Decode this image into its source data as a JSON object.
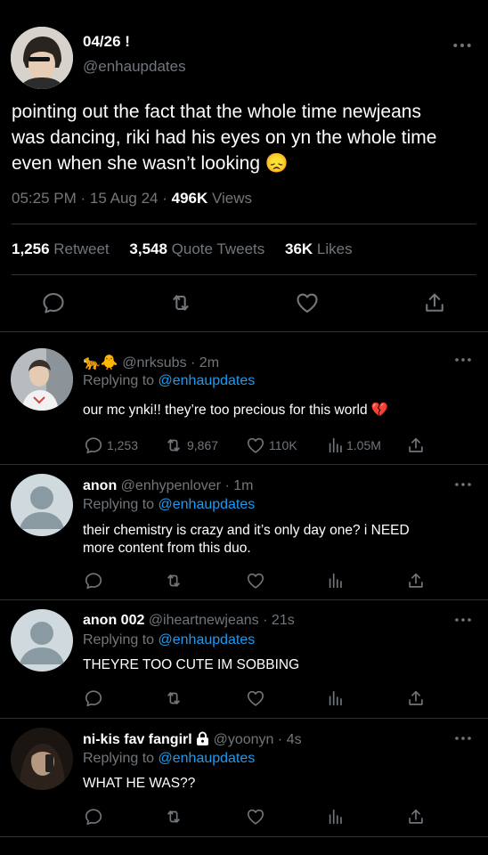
{
  "main_tweet": {
    "display_name": "04/26 !",
    "handle": "@enhaupdates",
    "text_lines": [
      "pointing out the fact that the whole time newjeans",
      "was dancing, riki had his eyes on yn the whole time",
      "even when she wasn’t looking 😞"
    ],
    "time": "05:25 PM",
    "date": "15 Aug 24",
    "separator": "·",
    "views_count": "496K",
    "views_label": "Views",
    "retweets_count": "1,256",
    "retweets_label": "Retweet",
    "quotes_count": "3,548",
    "quotes_label": "Quote Tweets",
    "likes_count": "36K",
    "likes_label": "Likes"
  },
  "replies": [
    {
      "name": "",
      "name_emoji": "🐆🐥",
      "handle": "@nrksubs",
      "separator": "·",
      "time": "2m",
      "replying_label": "Replying to",
      "replying_to": "@enhaupdates",
      "text": "our mc ynki!! they’re too precious for this world 💔",
      "reply_count": "1,253",
      "retweet_count": "9,867",
      "like_count": "110K",
      "view_count": "1.05M"
    },
    {
      "name": "anon",
      "handle": "@enhypenlover",
      "separator": "·",
      "time": "1m",
      "replying_label": "Replying to",
      "replying_to": "@enhaupdates",
      "text_lines": [
        "their chemistry is crazy and it’s only day one? i NEED",
        "more content from this duo."
      ]
    },
    {
      "name": "anon 002",
      "handle": "@iheartnewjeans",
      "separator": "·",
      "time": "21s",
      "replying_label": "Replying to",
      "replying_to": "@enhaupdates",
      "text": "THEYRE TOO CUTE IM SOBBING"
    },
    {
      "name": "ni-kis fav fangirl",
      "handle": "@yoonyn",
      "separator": "·",
      "time": "4s",
      "replying_label": "Replying to",
      "replying_to": "@enhaupdates",
      "text": "WHAT HE WAS??"
    }
  ],
  "icons": {
    "reply": "reply-icon",
    "retweet": "retweet-icon",
    "like": "heart-icon",
    "views": "views-icon",
    "share": "share-icon",
    "more": "more-icon",
    "lock": "lock-icon"
  },
  "colors": {
    "background": "#000000",
    "text": "#e7e9ea",
    "muted": "#71767b",
    "link": "#1d9bf0",
    "divider": "#2f3336"
  }
}
